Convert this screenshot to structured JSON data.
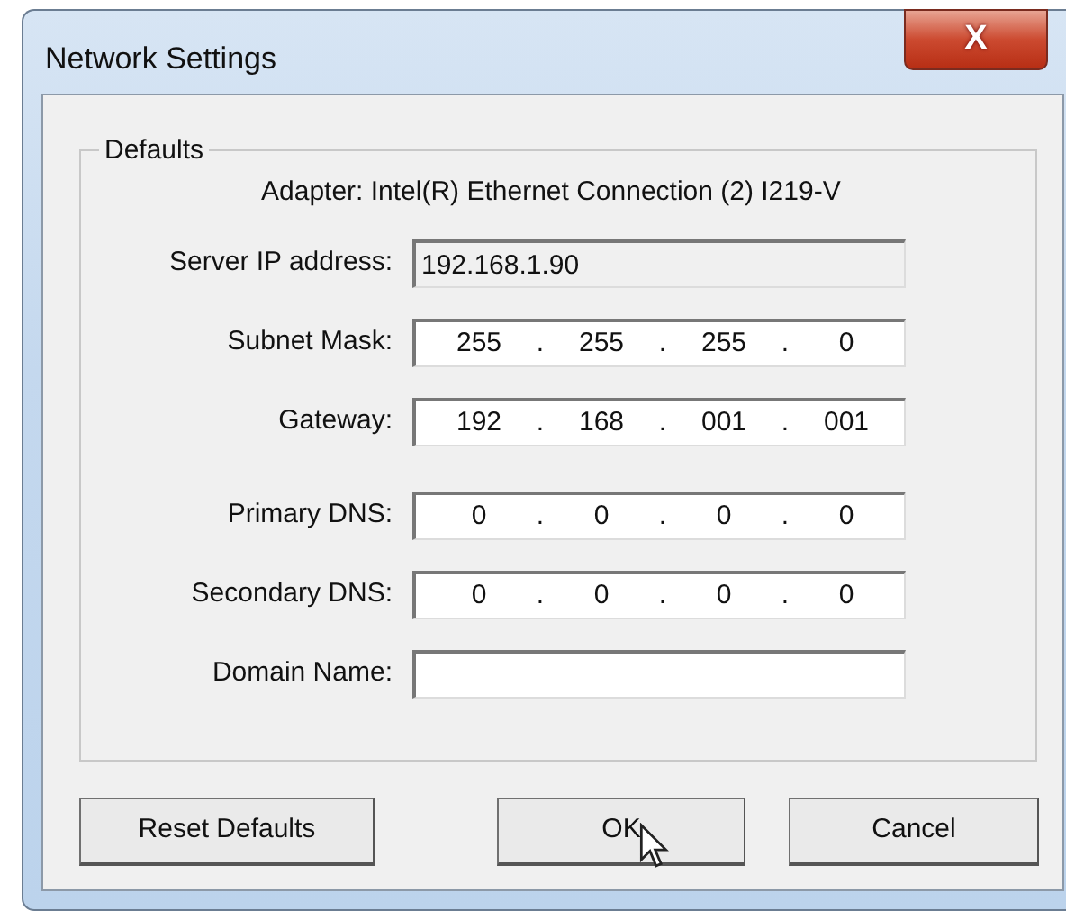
{
  "window": {
    "title": "Network Settings",
    "close_label": "X"
  },
  "group": {
    "title": "Defaults",
    "adapter": "Adapter: Intel(R) Ethernet Connection (2) I219-V"
  },
  "fields": [
    {
      "kind": "text",
      "label": "Server IP address:",
      "value": "192.168.1.90",
      "disabled": true
    },
    {
      "kind": "ip",
      "label": "Subnet Mask:",
      "octets": [
        "255",
        "255",
        "255",
        "0"
      ],
      "separator": "."
    },
    {
      "kind": "ip",
      "label": "Gateway:",
      "octets": [
        "192",
        "168",
        "001",
        "001"
      ],
      "separator": "."
    },
    {
      "kind": "ip",
      "label": "Primary DNS:",
      "octets": [
        "0",
        "0",
        "0",
        "0"
      ],
      "separator": "."
    },
    {
      "kind": "ip",
      "label": "Secondary DNS:",
      "octets": [
        "0",
        "0",
        "0",
        "0"
      ],
      "separator": "."
    },
    {
      "kind": "text",
      "label": "Domain Name:",
      "disabled": false
    }
  ],
  "buttons": [
    {
      "label": "Reset Defaults"
    },
    {
      "label": "OK"
    },
    {
      "label": "Cancel"
    }
  ]
}
